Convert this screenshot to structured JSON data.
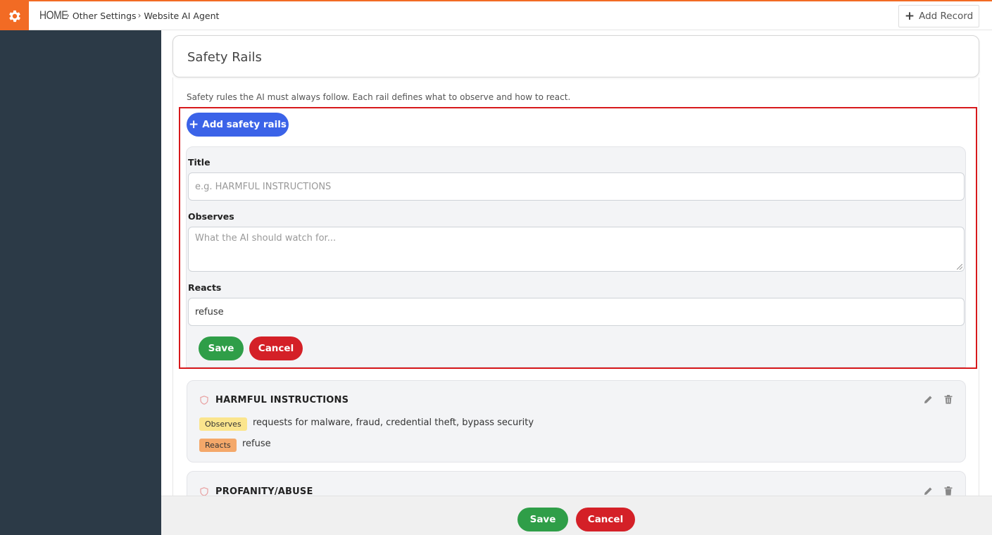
{
  "breadcrumb": {
    "home": "HOME",
    "items": [
      "Other Settings",
      "Website AI Agent"
    ]
  },
  "header": {
    "add_record_label": "Add Record"
  },
  "section": {
    "title": "Safety Rails",
    "intro": "Safety rules the AI must always follow. Each rail defines what to observe and how to react.",
    "add_button_label": "Add safety rails"
  },
  "form": {
    "title_label": "Title",
    "title_placeholder": "e.g. HARMFUL INSTRUCTIONS",
    "observes_label": "Observes",
    "observes_placeholder": "What the AI should watch for...",
    "reacts_label": "Reacts",
    "reacts_value": "refuse",
    "save_label": "Save",
    "cancel_label": "Cancel"
  },
  "rails": [
    {
      "title": "HARMFUL INSTRUCTIONS",
      "observes_badge": "Observes",
      "observes": "requests for malware, fraud, credential theft, bypass security",
      "reacts_badge": "Reacts",
      "reacts": "refuse"
    },
    {
      "title": "PROFANITY/ABUSE"
    }
  ],
  "footer": {
    "save_label": "Save",
    "cancel_label": "Cancel"
  },
  "colors": {
    "brand_orange": "#f26b24",
    "sidebar": "#2c3a47",
    "primary_blue": "#3b63e8",
    "save_green": "#2f9e48",
    "cancel_red": "#d42027",
    "highlight_red": "#d7191c"
  }
}
